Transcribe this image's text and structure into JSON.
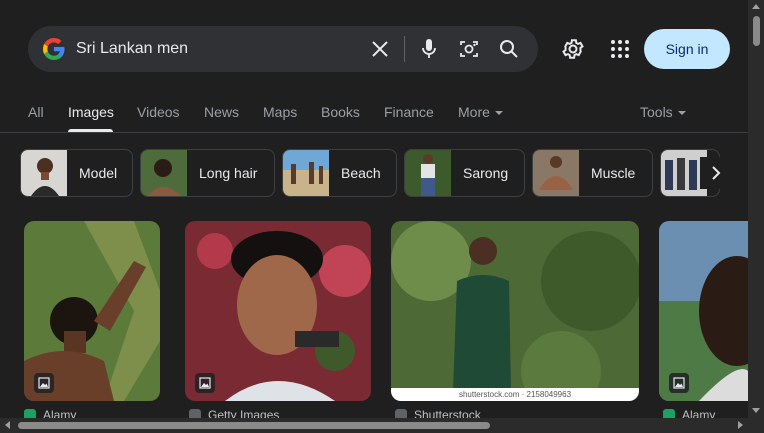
{
  "search": {
    "query": "Sri Lankan men",
    "logo_icon": "google-g-icon",
    "clear_icon": "close-icon",
    "voice_icon": "microphone-icon",
    "lens_icon": "camera-lens-icon",
    "search_icon": "search-icon"
  },
  "header": {
    "settings_icon": "gear-icon",
    "apps_icon": "apps-grid-icon",
    "signin_label": "Sign in"
  },
  "tabs": [
    {
      "label": "All"
    },
    {
      "label": "Images",
      "active": true
    },
    {
      "label": "Videos"
    },
    {
      "label": "News"
    },
    {
      "label": "Maps"
    },
    {
      "label": "Books"
    },
    {
      "label": "Finance"
    },
    {
      "label": "More"
    }
  ],
  "tools_label": "Tools",
  "chips": [
    {
      "label": "Model"
    },
    {
      "label": "Long hair"
    },
    {
      "label": "Beach"
    },
    {
      "label": "Sarong"
    },
    {
      "label": "Muscle"
    }
  ],
  "results": [
    {
      "source": "Alamy",
      "source_color": "#1aa260"
    },
    {
      "source": "Getty Images",
      "source_color": "#5f6368"
    },
    {
      "source": "Shutterstock",
      "source_color": "#5f6368",
      "caption": "shutterstock.com · 2158049963"
    },
    {
      "source": "Alamy",
      "source_color": "#1aa260"
    }
  ],
  "colors": {
    "background": "#1f1f1f",
    "search_bg": "#303134",
    "signin_bg": "#c2e7ff",
    "signin_text": "#062e6f"
  }
}
